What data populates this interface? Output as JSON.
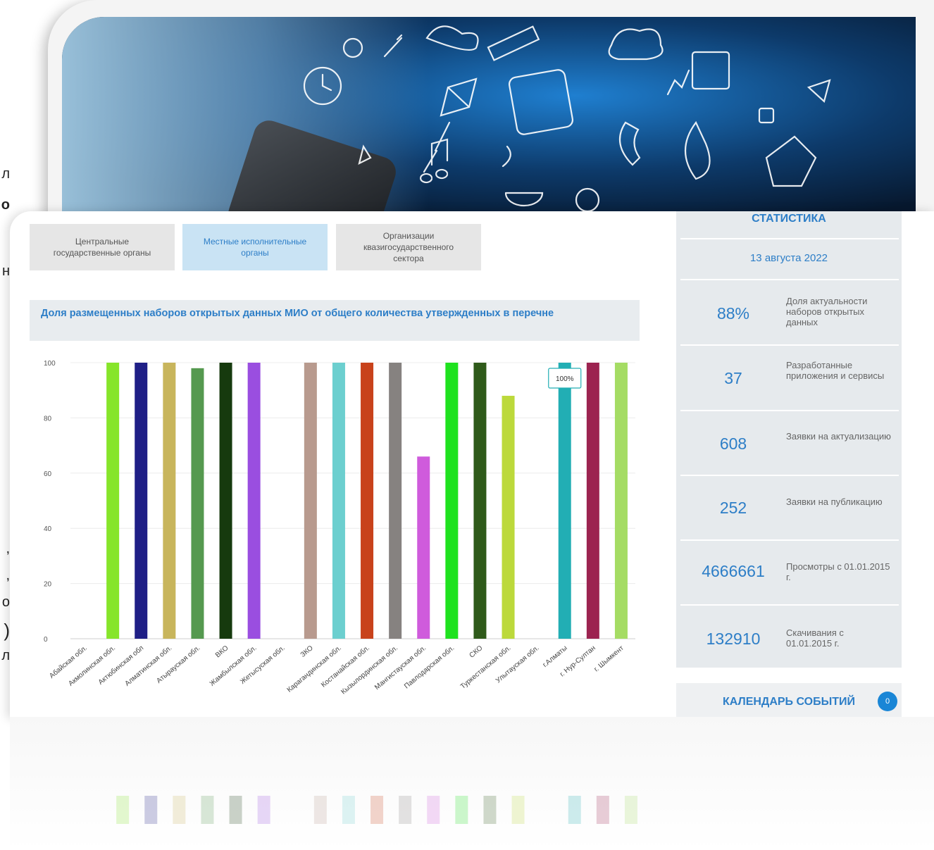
{
  "tabs": [
    {
      "label": "Центральные государственные органы",
      "active": false
    },
    {
      "label": "Местные исполнительные органы",
      "active": true
    },
    {
      "label": "Организации квазигосударственного сектора",
      "active": false
    }
  ],
  "chart_title": "Доля размещенных наборов открытых данных МИО от общего количества утвержденных в перечне",
  "chart_data": {
    "type": "bar",
    "title": "Доля размещенных наборов открытых данных МИО от общего количества утвержденных в перечне",
    "xlabel": "",
    "ylabel": "",
    "ylim": [
      0,
      100
    ],
    "yticks": [
      0,
      20,
      40,
      60,
      80,
      100
    ],
    "grid": true,
    "categories": [
      "Абайская обл.",
      "Акмолинская обл.",
      "Актюбинская обл",
      "Алматинская обл.",
      "Атырауская обл.",
      "ВКО",
      "Жамбылская обл.",
      "Жетысуская обл.",
      "ЗКО",
      "Карагандинская обл.",
      "Костанайская обл.",
      "Кызылординская обл.",
      "Мангистауская обл.",
      "Павлодарская обл.",
      "СКО",
      "Туркестанская обл.",
      "Улытауская обл.",
      "г.Алматы",
      "г. Нур-Султан",
      "г. Шымкент"
    ],
    "values": [
      0,
      100,
      100,
      100,
      98,
      100,
      100,
      0,
      100,
      100,
      100,
      100,
      66,
      100,
      100,
      88,
      0,
      100,
      100,
      100
    ],
    "colors": [
      "#7ec42f",
      "#86e52a",
      "#1f1f86",
      "#c8b55c",
      "#55994f",
      "#163a0e",
      "#9a4ee0",
      "#999999",
      "#b89a8e",
      "#6ccfcf",
      "#c8421b",
      "#868280",
      "#cf5bdc",
      "#1fe21f",
      "#2f5a1a",
      "#bcd93b",
      "#999999",
      "#22aeb4",
      "#9c2350",
      "#a5dc64"
    ],
    "tooltip": {
      "category": "г.Алматы",
      "text": "100%"
    }
  },
  "stats": {
    "title": "СТАТИСТИКА",
    "date": "13 августа 2022",
    "items": [
      {
        "value": "88%",
        "label": "Доля актуальности наборов открытых данных"
      },
      {
        "value": "37",
        "label": "Разработанные приложения и сервисы"
      },
      {
        "value": "608",
        "label": "Заявки на актуализацию"
      },
      {
        "value": "252",
        "label": "Заявки на публикацию"
      },
      {
        "value": "4666661",
        "label": "Просмотры с 01.01.2015 г."
      },
      {
        "value": "132910",
        "label": "Скачивания с 01.01.2015 г."
      }
    ]
  },
  "calendar": {
    "label": "КАЛЕНДАРЬ СОБЫТИЙ",
    "count": "0"
  },
  "edge_glyphs": [
    "л",
    "о",
    "н",
    ",",
    ",",
    "о",
    ")",
    "л"
  ]
}
